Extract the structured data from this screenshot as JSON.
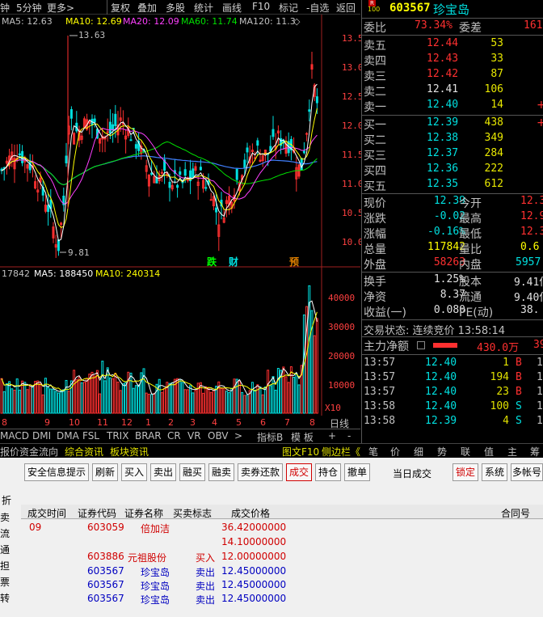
{
  "toolbar": {
    "items": [
      "钟",
      "5分钟",
      "更多>",
      "复权",
      "叠加",
      "多股",
      "统计",
      "画线",
      "F10",
      "标记",
      "-自选",
      "返回"
    ]
  },
  "legend": {
    "ma5": "MA5: 12.63",
    "ma10": "MA10: 12.69",
    "ma20": "MA20: 12.09",
    "ma60": "MA60: 11.74",
    "ma120": "MA120: 11.3"
  },
  "price_axis": [
    "13.50",
    "13.00",
    "12.50",
    "12.00",
    "11.50",
    "11.00",
    "10.50",
    "10.00"
  ],
  "price_annotations": {
    "high": "13.63",
    "low": "9.81",
    "mark_die": "跌",
    "mark_cai": "财",
    "mark_yu": "预"
  },
  "volume_legend": {
    "vol": "17842",
    "ma5": "MA5: 188450",
    "ma10": "MA10: 240314"
  },
  "volume_axis": [
    "40000",
    "30000",
    "20000",
    "10000",
    "X10"
  ],
  "date_ticks": [
    "8",
    "9",
    "10",
    "11",
    "12",
    "1",
    "2",
    "3",
    "4",
    "5",
    "6",
    "7",
    "8"
  ],
  "date_axis_label": "日线",
  "indicator_tabs": [
    "MACD",
    "DMI",
    "DMA",
    "FSL",
    "TRIX",
    "BRAR",
    "CR",
    "VR",
    "OBV",
    ">",
    "指标B",
    "模 板",
    "+",
    "-"
  ],
  "bottom_tabs": [
    "报价",
    "资金流向",
    "综合资讯",
    "板块资讯",
    "图文F10",
    "侧边栏《",
    "笔",
    "价",
    "细",
    "势",
    "联",
    "值",
    "主",
    "筹"
  ],
  "stock": {
    "badge": "R",
    "code": "603567",
    "name": "珍宝岛"
  },
  "weibi": {
    "label1": "委比",
    "value1": "73.34%",
    "label2": "委差",
    "value2": "161"
  },
  "asks": [
    {
      "label": "卖五",
      "price": "12.44",
      "vol": "53"
    },
    {
      "label": "卖四",
      "price": "12.43",
      "vol": "33"
    },
    {
      "label": "卖三",
      "price": "12.42",
      "vol": "87"
    },
    {
      "label": "卖二",
      "price": "12.41",
      "vol": "106"
    },
    {
      "label": "卖一",
      "price": "12.40",
      "vol": "14",
      "extra": "+"
    }
  ],
  "bids": [
    {
      "label": "买一",
      "price": "12.39",
      "vol": "438",
      "extra": "+"
    },
    {
      "label": "买二",
      "price": "12.38",
      "vol": "349"
    },
    {
      "label": "买三",
      "price": "12.37",
      "vol": "284"
    },
    {
      "label": "买四",
      "price": "12.36",
      "vol": "222"
    },
    {
      "label": "买五",
      "price": "12.35",
      "vol": "612"
    }
  ],
  "quote": [
    {
      "l1": "现价",
      "v1": "12.39",
      "l2": "今开",
      "v2": "12.3"
    },
    {
      "l1": "涨跌",
      "v1": "-0.02",
      "l2": "最高",
      "v2": "12.9"
    },
    {
      "l1": "涨幅",
      "v1": "-0.16%",
      "l2": "最低",
      "v2": "12.3"
    },
    {
      "l1": "总量",
      "v1": "117842",
      "l2": "量比",
      "v2": "0.6"
    },
    {
      "l1": "外盘",
      "v1": "58263",
      "l2": "内盘",
      "v2": "5957"
    }
  ],
  "fundamentals": [
    {
      "l1": "换手",
      "v1": "1.25%",
      "l2": "股本",
      "v2": "9.41亿"
    },
    {
      "l1": "净资",
      "v1": "8.37",
      "l2": "流通",
      "v2": "9.40亿"
    },
    {
      "l1": "收益(一)",
      "v1": "0.080",
      "l2": "PE(动)",
      "v2": "38."
    }
  ],
  "trade_status": "交易状态: 连续竞价 13:58:14",
  "main_flow": {
    "label": "主力净额",
    "value": "430.0万",
    "extra": "39"
  },
  "ticks": [
    {
      "time": "13:57",
      "price": "12.40",
      "vol": "1",
      "side": "B",
      "n": "1"
    },
    {
      "time": "13:57",
      "price": "12.40",
      "vol": "194",
      "side": "B",
      "n": "1"
    },
    {
      "time": "13:57",
      "price": "12.40",
      "vol": "23",
      "side": "B",
      "n": "1"
    },
    {
      "time": "13:58",
      "price": "12.40",
      "vol": "100",
      "side": "S",
      "n": "1"
    },
    {
      "time": "13:58",
      "price": "12.39",
      "vol": "4",
      "side": "S",
      "n": "1"
    }
  ],
  "trade_buttons": [
    "安全信息提示",
    "刷新",
    "买入",
    "卖出",
    "融买",
    "融卖",
    "卖券还款",
    "成交",
    "持仓",
    "撤单",
    "当日成交",
    "锁定",
    "系统",
    "多帐号"
  ],
  "left_side_labels": [
    "折",
    "卖",
    "流",
    "通",
    "担",
    "票",
    "转"
  ],
  "table_headers": [
    "成交时间",
    "证券代码",
    "证券名称",
    "买卖标志",
    "成交价格",
    "合同号"
  ],
  "table_rows": [
    {
      "time": "09",
      "code": "603059",
      "name": "倍加洁",
      "flag": "",
      "price": "36.42000000"
    },
    {
      "time": "",
      "code": "",
      "name": "",
      "flag": "",
      "price": "14.10000000"
    },
    {
      "time": "",
      "code": "603886",
      "name": "元祖股份",
      "flag": "买入",
      "price": "12.00000000"
    },
    {
      "time": "",
      "code": "603567",
      "name": "珍宝岛",
      "flag": "卖出",
      "price": "12.45000000"
    },
    {
      "time": "",
      "code": "603567",
      "name": "珍宝岛",
      "flag": "卖出",
      "price": "12.45000000"
    },
    {
      "time": "",
      "code": "603567",
      "name": "珍宝岛",
      "flag": "卖出",
      "price": "12.45000000"
    }
  ],
  "colors": {
    "up": "#ff3030",
    "down": "#00e0e0",
    "ma5": "#ffffff",
    "ma10": "#ffff00",
    "ma20": "#ff40ff",
    "ma60": "#00ff00",
    "ma120": "#4080ff"
  }
}
